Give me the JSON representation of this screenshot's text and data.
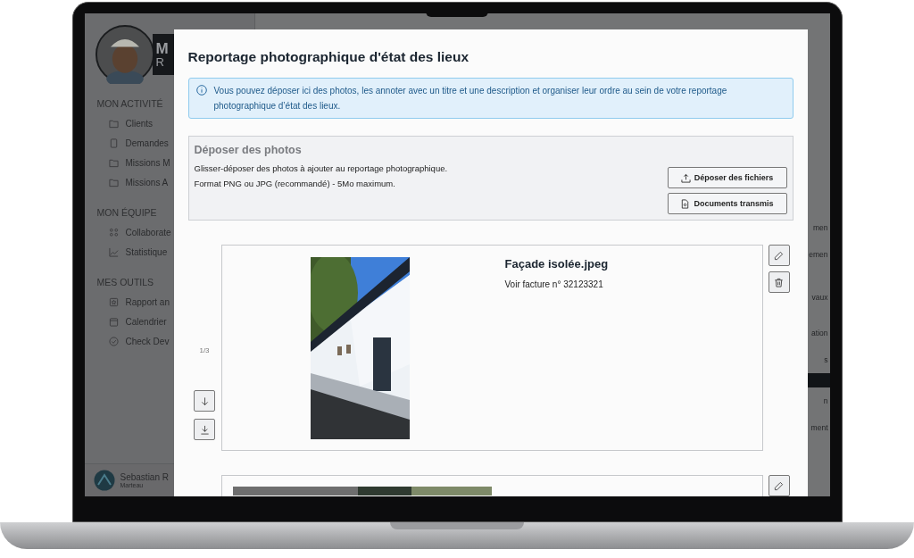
{
  "sidebar": {
    "logo_letters": [
      "M",
      "R"
    ],
    "sections": [
      {
        "title": "MON ACTIVITÉ",
        "items": [
          {
            "label": "Clients"
          },
          {
            "label": "Demandes"
          },
          {
            "label": "Missions M"
          },
          {
            "label": "Missions A"
          }
        ]
      },
      {
        "title": "MON ÉQUIPE",
        "items": [
          {
            "label": "Collaborate"
          },
          {
            "label": "Statistique"
          }
        ]
      },
      {
        "title": "MES OUTILS",
        "items": [
          {
            "label": "Rapport an"
          },
          {
            "label": "Calendrier"
          },
          {
            "label": "Check Dev"
          }
        ]
      }
    ],
    "user": {
      "name": "Sebastian R",
      "role": "Marteau"
    }
  },
  "background_fragments": [
    "men",
    "emen",
    "vaux",
    "ation",
    "s",
    "n",
    "ment"
  ],
  "modal": {
    "title": "Reportage photographique d'état des lieux",
    "info": "Vous pouvez déposer ici des photos, les annoter avec un titre et une description et organiser leur ordre au sein de votre reportage photographique d’état des lieux.",
    "dropzone": {
      "title": "Déposer des photos",
      "lines": [
        "Glisser-déposer des photos à ajouter au reportage photographique.",
        "Format PNG ou JPG (recommandé) - 5Mo maximum."
      ],
      "buttons": [
        {
          "label": "Déposer des fichiers",
          "kind": "upload"
        },
        {
          "label": "Documents transmis",
          "kind": "document"
        }
      ]
    },
    "photos": [
      {
        "counter": "1/3",
        "title": "Façade isolée.jpeg",
        "description": "Voir facture n° 32123321",
        "kind": "picture"
      },
      {
        "kind": "picture"
      }
    ]
  }
}
